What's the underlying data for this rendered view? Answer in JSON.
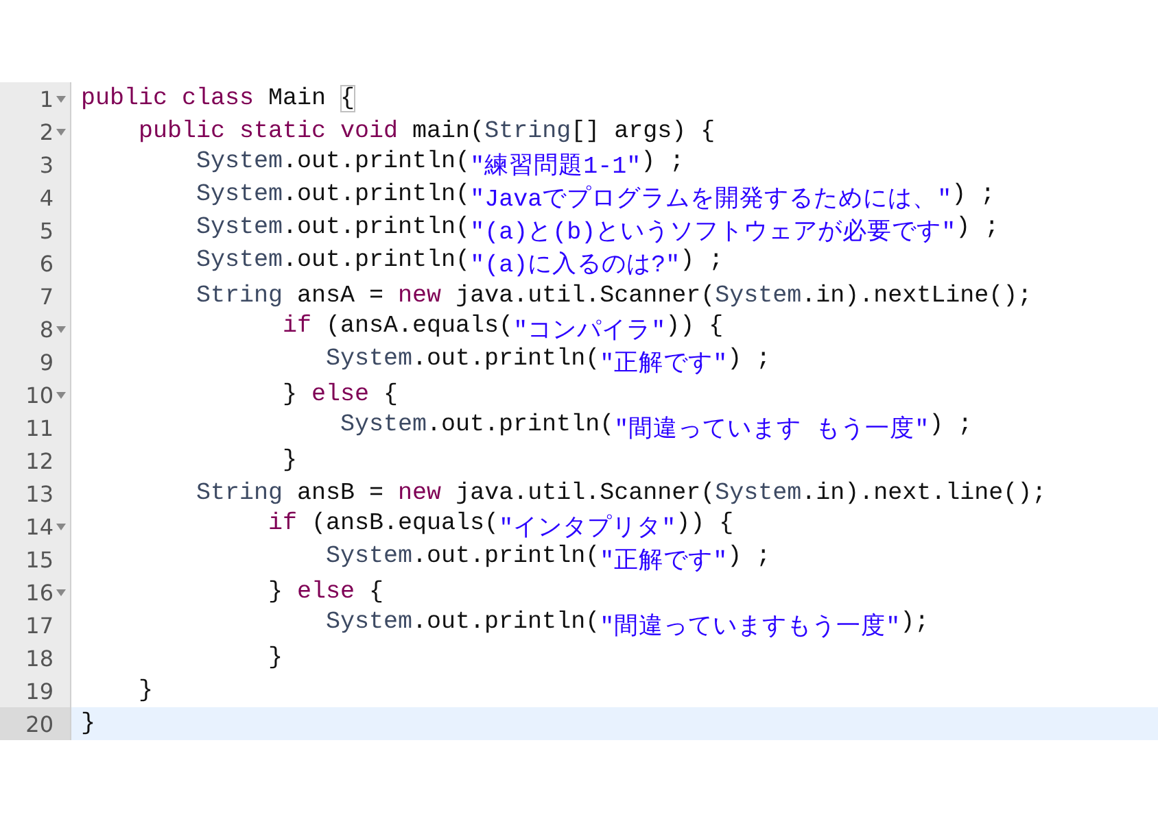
{
  "editor": {
    "lines": [
      {
        "number": "1",
        "foldable": true,
        "active": false,
        "tokens": [
          {
            "kind": "keyword",
            "text": "public class"
          },
          {
            "kind": "plain",
            "text": " Main "
          },
          {
            "kind": "bracket-match",
            "text": "{"
          }
        ]
      },
      {
        "number": "2",
        "foldable": true,
        "active": false,
        "tokens": [
          {
            "kind": "keyword",
            "text": "    public static void"
          },
          {
            "kind": "plain",
            "text": " main("
          },
          {
            "kind": "type",
            "text": "String"
          },
          {
            "kind": "plain",
            "text": "[] args) {"
          }
        ]
      },
      {
        "number": "3",
        "foldable": false,
        "active": false,
        "tokens": [
          {
            "kind": "type",
            "text": "        System"
          },
          {
            "kind": "plain",
            "text": ".out.println("
          },
          {
            "kind": "string",
            "text": "\"練習問題1-1\""
          },
          {
            "kind": "plain",
            "text": ") ;"
          }
        ]
      },
      {
        "number": "4",
        "foldable": false,
        "active": false,
        "tokens": [
          {
            "kind": "type",
            "text": "        System"
          },
          {
            "kind": "plain",
            "text": ".out.println("
          },
          {
            "kind": "string",
            "text": "\"Javaでプログラムを開発するためには、\""
          },
          {
            "kind": "plain",
            "text": ") ;"
          }
        ]
      },
      {
        "number": "5",
        "foldable": false,
        "active": false,
        "tokens": [
          {
            "kind": "type",
            "text": "        System"
          },
          {
            "kind": "plain",
            "text": ".out.println("
          },
          {
            "kind": "string",
            "text": "\"(a)と(b)というソフトウェアが必要です\""
          },
          {
            "kind": "plain",
            "text": ") ;"
          }
        ]
      },
      {
        "number": "6",
        "foldable": false,
        "active": false,
        "tokens": [
          {
            "kind": "type",
            "text": "        System"
          },
          {
            "kind": "plain",
            "text": ".out.println("
          },
          {
            "kind": "string",
            "text": "\"(a)に入るのは?\""
          },
          {
            "kind": "plain",
            "text": ") ;"
          }
        ]
      },
      {
        "number": "7",
        "foldable": false,
        "active": false,
        "tokens": [
          {
            "kind": "type",
            "text": "        String"
          },
          {
            "kind": "plain",
            "text": " ansA = "
          },
          {
            "kind": "keyword",
            "text": "new"
          },
          {
            "kind": "plain",
            "text": " java.util.Scanner("
          },
          {
            "kind": "type",
            "text": "System"
          },
          {
            "kind": "plain",
            "text": ".in).nextLine();"
          }
        ]
      },
      {
        "number": "8",
        "foldable": true,
        "active": false,
        "tokens": [
          {
            "kind": "keyword",
            "text": "              if"
          },
          {
            "kind": "plain",
            "text": " (ansA.equals("
          },
          {
            "kind": "string",
            "text": "\"コンパイラ\""
          },
          {
            "kind": "plain",
            "text": ")) {"
          }
        ]
      },
      {
        "number": "9",
        "foldable": false,
        "active": false,
        "tokens": [
          {
            "kind": "type",
            "text": "                 System"
          },
          {
            "kind": "plain",
            "text": ".out.println("
          },
          {
            "kind": "string",
            "text": "\"正解です\""
          },
          {
            "kind": "plain",
            "text": ") ;"
          }
        ]
      },
      {
        "number": "10",
        "foldable": true,
        "active": false,
        "tokens": [
          {
            "kind": "plain",
            "text": "              } "
          },
          {
            "kind": "keyword",
            "text": "else"
          },
          {
            "kind": "plain",
            "text": " {"
          }
        ]
      },
      {
        "number": "11",
        "foldable": false,
        "active": false,
        "tokens": [
          {
            "kind": "type",
            "text": "                  System"
          },
          {
            "kind": "plain",
            "text": ".out.println("
          },
          {
            "kind": "string",
            "text": "\"間違っています もう一度\""
          },
          {
            "kind": "plain",
            "text": ") ;"
          }
        ]
      },
      {
        "number": "12",
        "foldable": false,
        "active": false,
        "tokens": [
          {
            "kind": "plain",
            "text": "              }"
          }
        ]
      },
      {
        "number": "13",
        "foldable": false,
        "active": false,
        "tokens": [
          {
            "kind": "type",
            "text": "        String"
          },
          {
            "kind": "plain",
            "text": " ansB = "
          },
          {
            "kind": "keyword",
            "text": "new"
          },
          {
            "kind": "plain",
            "text": " java.util.Scanner("
          },
          {
            "kind": "type",
            "text": "System"
          },
          {
            "kind": "plain",
            "text": ".in).next.line();"
          }
        ]
      },
      {
        "number": "14",
        "foldable": true,
        "active": false,
        "tokens": [
          {
            "kind": "keyword",
            "text": "             if"
          },
          {
            "kind": "plain",
            "text": " (ansB.equals("
          },
          {
            "kind": "string",
            "text": "\"インタプリタ\""
          },
          {
            "kind": "plain",
            "text": ")) {"
          }
        ]
      },
      {
        "number": "15",
        "foldable": false,
        "active": false,
        "tokens": [
          {
            "kind": "type",
            "text": "                 System"
          },
          {
            "kind": "plain",
            "text": ".out.println("
          },
          {
            "kind": "string",
            "text": "\"正解です\""
          },
          {
            "kind": "plain",
            "text": ") ;"
          }
        ]
      },
      {
        "number": "16",
        "foldable": true,
        "active": false,
        "tokens": [
          {
            "kind": "plain",
            "text": "             } "
          },
          {
            "kind": "keyword",
            "text": "else"
          },
          {
            "kind": "plain",
            "text": " {"
          }
        ]
      },
      {
        "number": "17",
        "foldable": false,
        "active": false,
        "tokens": [
          {
            "kind": "type",
            "text": "                 System"
          },
          {
            "kind": "plain",
            "text": ".out.println("
          },
          {
            "kind": "string",
            "text": "\"間違っていますもう一度\""
          },
          {
            "kind": "plain",
            "text": ");"
          }
        ]
      },
      {
        "number": "18",
        "foldable": false,
        "active": false,
        "tokens": [
          {
            "kind": "plain",
            "text": "             }"
          }
        ]
      },
      {
        "number": "19",
        "foldable": false,
        "active": false,
        "tokens": [
          {
            "kind": "plain",
            "text": "    }"
          }
        ]
      },
      {
        "number": "20",
        "foldable": false,
        "active": true,
        "tokens": [
          {
            "kind": "plain",
            "text": "}"
          }
        ]
      }
    ]
  }
}
